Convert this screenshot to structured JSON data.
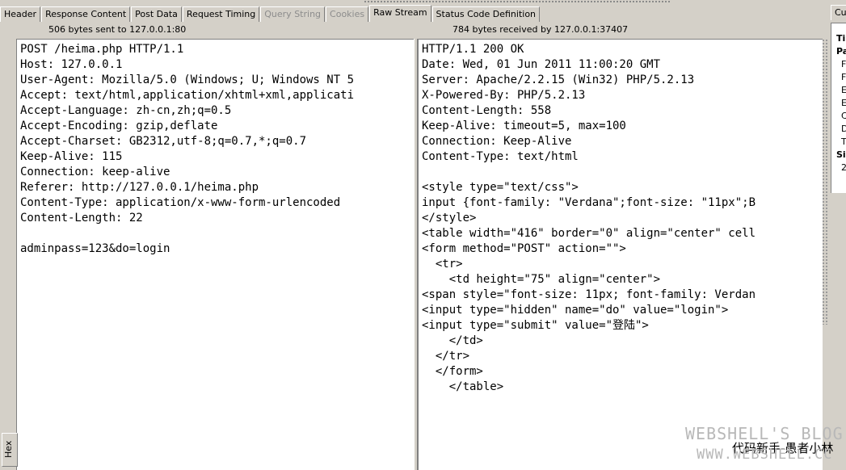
{
  "tabs": [
    {
      "label": "Header",
      "state": "normal"
    },
    {
      "label": "Response Content",
      "state": "normal"
    },
    {
      "label": "Post Data",
      "state": "normal"
    },
    {
      "label": "Request Timing",
      "state": "normal"
    },
    {
      "label": "Query String",
      "state": "disabled"
    },
    {
      "label": "Cookies",
      "state": "disabled"
    },
    {
      "label": "Raw Stream",
      "state": "active"
    },
    {
      "label": "Status Code Definition",
      "state": "normal"
    }
  ],
  "request": {
    "info": "506 bytes sent to 127.0.0.1:80",
    "lines": [
      "POST /heima.php HTTP/1.1",
      "Host: 127.0.0.1",
      "User-Agent: Mozilla/5.0 (Windows; U; Windows NT 5",
      "Accept: text/html,application/xhtml+xml,applicati",
      "Accept-Language: zh-cn,zh;q=0.5",
      "Accept-Encoding: gzip,deflate",
      "Accept-Charset: GB2312,utf-8;q=0.7,*;q=0.7",
      "Keep-Alive: 115",
      "Connection: keep-alive",
      "Referer: http://127.0.0.1/heima.php",
      "Content-Type: application/x-www-form-urlencoded",
      "Content-Length: 22",
      "",
      "adminpass=123&do=login"
    ]
  },
  "response": {
    "info": "784 bytes received by 127.0.0.1:37407",
    "lines": [
      "HTTP/1.1 200 OK",
      "Date: Wed, 01 Jun 2011 11:00:20 GMT",
      "Server: Apache/2.2.15 (Win32) PHP/5.2.13",
      "X-Powered-By: PHP/5.2.13",
      "Content-Length: 558",
      "Keep-Alive: timeout=5, max=100",
      "Connection: Keep-Alive",
      "Content-Type: text/html",
      "",
      "<style type=\"text/css\">",
      "input {font-family: \"Verdana\";font-size: \"11px\";B",
      "</style>",
      "<table width=\"416\" border=\"0\" align=\"center\" cell",
      "<form method=\"POST\" action=\"\">",
      "  <tr>",
      "    <td height=\"75\" align=\"center\">",
      "<span style=\"font-size: 11px; font-family: Verdan",
      "<input type=\"hidden\" name=\"do\" value=\"login\">",
      "<input type=\"submit\" value=\"登陆\">",
      "    </td>",
      "  </tr>",
      "  </form>",
      "    </table>"
    ]
  },
  "side_tab": {
    "label": "Hex"
  },
  "right_panel": {
    "tab_label": "Cu",
    "lines": [
      "Ti",
      "Pa",
      "F",
      "F",
      "E",
      "E",
      "C",
      "D",
      "T",
      "Si",
      "2"
    ]
  },
  "watermark": {
    "line1": "WEBSHELL'S BLOG",
    "line2": "代码新手-愚者小林",
    "line3": "WWW.WEBSHELL.CC"
  }
}
